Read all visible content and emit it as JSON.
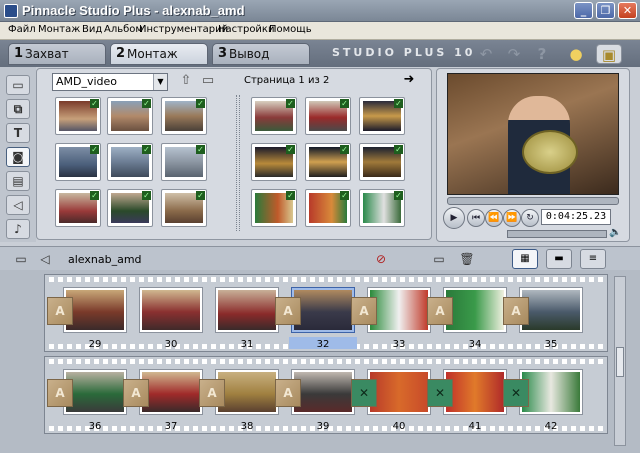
{
  "window": {
    "title": "Pinnacle Studio Plus - alexnab_amd",
    "min_label": "_",
    "max_label": "❐",
    "close_label": "✕"
  },
  "menu": [
    "Файл",
    "Монтаж",
    "Вид",
    "Альбом",
    "Инструментарий",
    "Настройки",
    "Помощь"
  ],
  "tabs": [
    {
      "num": "1",
      "label": "Захват"
    },
    {
      "num": "2",
      "label": "Монтаж"
    },
    {
      "num": "3",
      "label": "Вывод фильма"
    }
  ],
  "brand": "STUDIO PLUS 10",
  "album": {
    "selected": "AMD_video",
    "page_label": "Страница 1 из 2"
  },
  "preview": {
    "timecode": "0:04:25.23"
  },
  "storyboard": {
    "project_name": "alexnab_amd",
    "row1_numbers": [
      "29",
      "30",
      "31",
      "32",
      "33",
      "34",
      "35"
    ],
    "row2_numbers": [
      "36",
      "37",
      "38",
      "39",
      "40",
      "41",
      "42"
    ]
  },
  "colors": {
    "accent": "#3d63a8",
    "check": "#1e5e1e"
  }
}
